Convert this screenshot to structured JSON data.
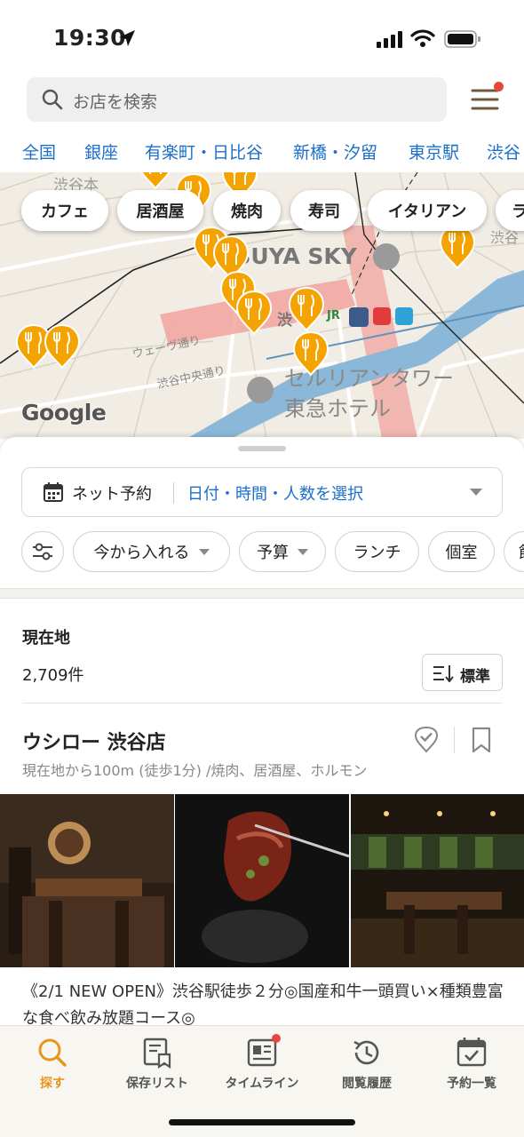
{
  "status": {
    "time": "19:30"
  },
  "search": {
    "placeholder": "お店を検索"
  },
  "area_tabs": [
    "全国",
    "銀座",
    "有楽町・日比谷",
    "新橋・汐留",
    "東京駅",
    "渋谷"
  ],
  "map": {
    "categories": [
      "カフェ",
      "居酒屋",
      "焼肉",
      "寿司",
      "イタリアン",
      "ラ"
    ],
    "labels": {
      "shibuya_sky": "IBUYA SKY",
      "cerulean": "セルリアンタワー",
      "tokyu_hotel": "東急ホテル",
      "waves_st": "ウェーヴ通り",
      "chuo_st": "渋谷中央通り",
      "shibuya_top": "渋谷本",
      "shibuya_left": "渋",
      "shibuya_right": "渋谷",
      "jr": "JR"
    },
    "attribution": "Google",
    "pin_color": "#f5a300"
  },
  "reservation": {
    "label": "ネット予約",
    "selector": "日付・時間・人数を選択"
  },
  "filters": [
    "今から入れる",
    "予算",
    "ランチ",
    "個室",
    "飲"
  ],
  "results": {
    "location_title": "現在地",
    "count": "2,709件",
    "sort_label": "標準"
  },
  "shop": {
    "name": "ウシロー 渋谷店",
    "meta": "現在地から100m (徒歩1分) /焼肉、居酒屋、ホルモン",
    "description": "《2/1 NEW OPEN》渋谷駅徒歩２分◎国産和牛一頭買い×種類豊富な食べ飲み放題コース◎"
  },
  "tabs": [
    "探す",
    "保存リスト",
    "タイムライン",
    "閲覧履歴",
    "予約一覧"
  ],
  "colors": {
    "accent": "#e8951d",
    "link": "#1b6fc9",
    "badge": "#e8453c"
  }
}
